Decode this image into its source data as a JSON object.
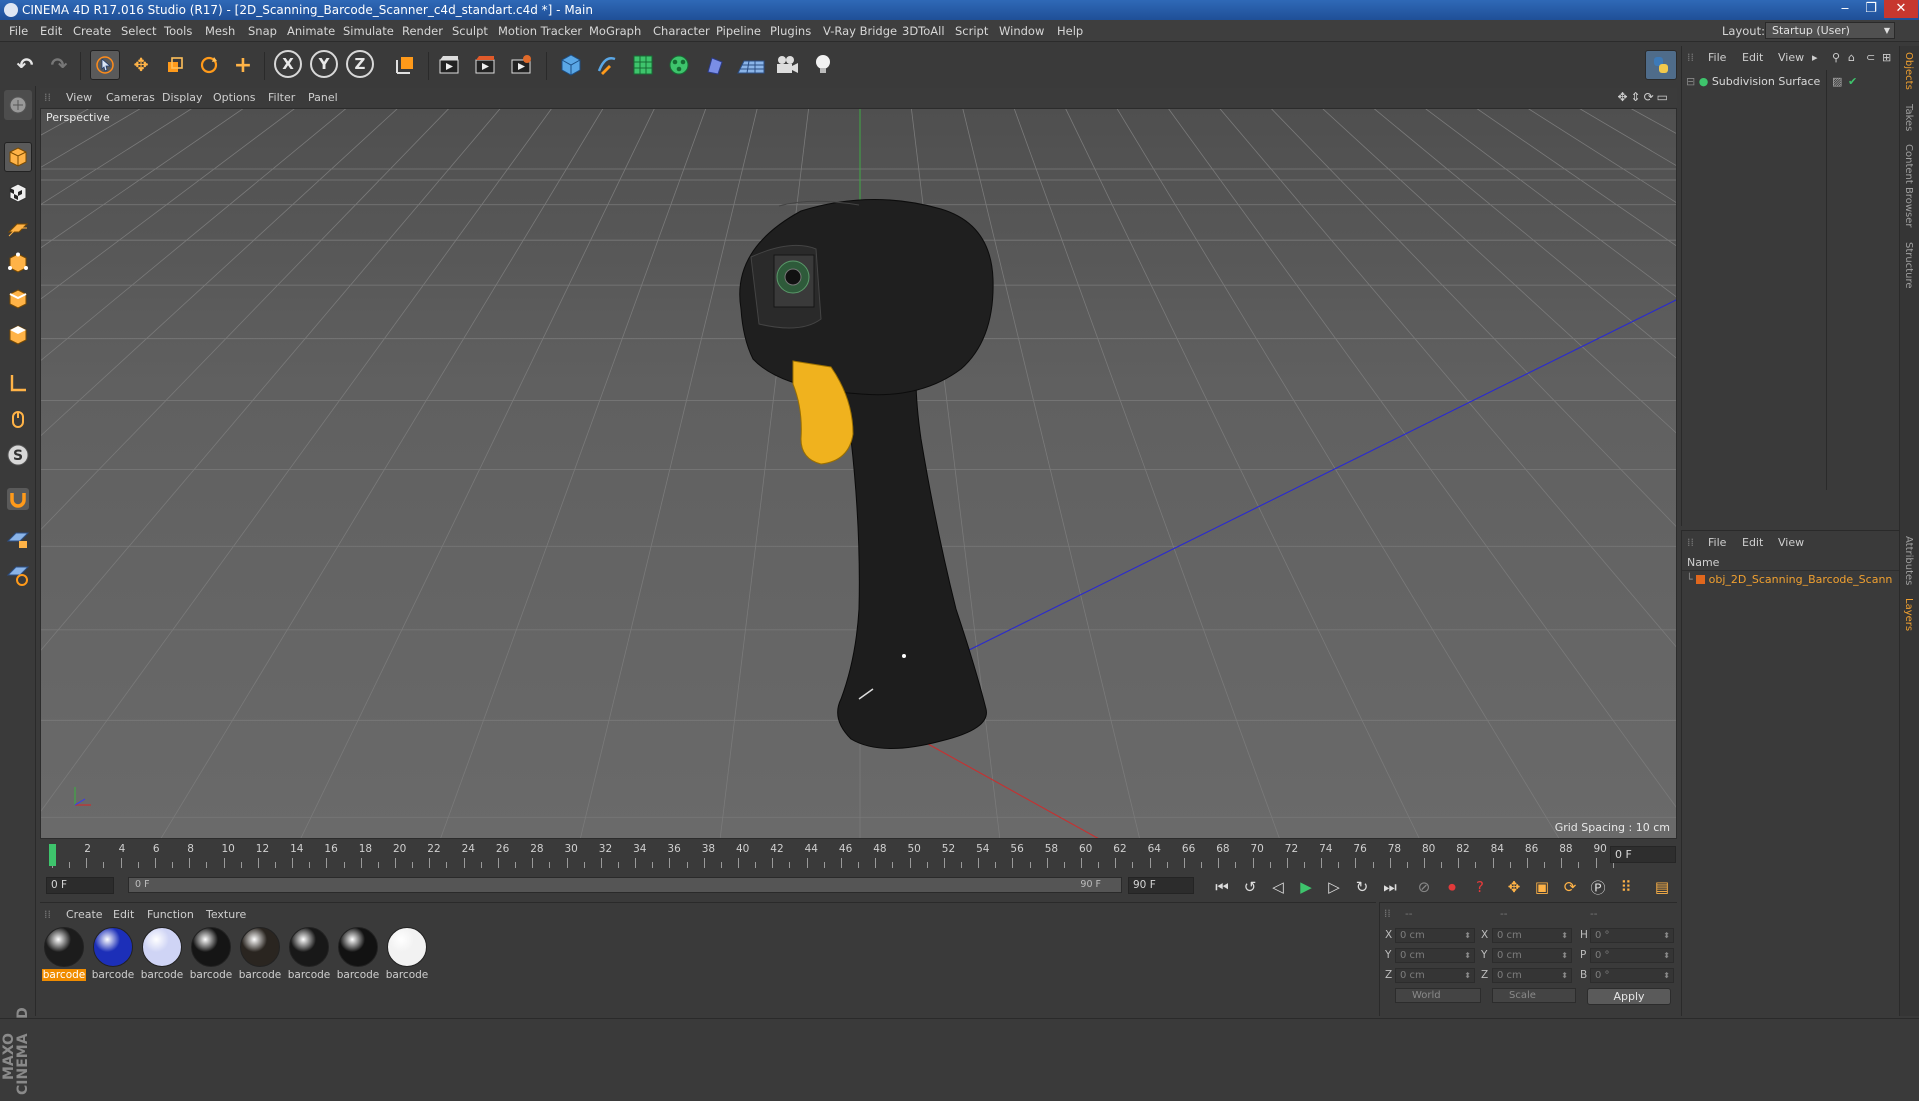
{
  "window": {
    "title": "CINEMA 4D R17.016 Studio (R17) - [2D_Scanning_Barcode_Scanner_c4d_standart.c4d *] - Main",
    "minimize": "‒",
    "maximize": "❐",
    "close": "✕"
  },
  "menubar": {
    "items": [
      "File",
      "Edit",
      "Create",
      "Select",
      "Tools",
      "Mesh",
      "Snap",
      "Animate",
      "Simulate",
      "Render",
      "Sculpt",
      "Motion Tracker",
      "MoGraph",
      "Character",
      "Pipeline",
      "Plugins",
      "V-Ray Bridge",
      "3DToAll",
      "Script",
      "Window",
      "Help"
    ],
    "layout_label": "Layout:",
    "layout_value": "Startup (User)"
  },
  "toolbar": {
    "icons": [
      "undo-icon",
      "redo-icon",
      "select-icon",
      "move-icon",
      "scale-icon",
      "rotate-icon",
      "transform-icon",
      "x-axis-icon",
      "y-axis-icon",
      "z-axis-icon",
      "coordinate-system-icon",
      "render-view-icon",
      "render-picture-icon",
      "render-settings-icon",
      "cube-icon",
      "pen-icon",
      "subdivision-icon",
      "cloner-icon",
      "deformer-icon",
      "floor-icon",
      "camera-icon",
      "light-icon"
    ],
    "x_label": "X",
    "y_label": "Y",
    "z_label": "Z",
    "python_icon": "python-icon"
  },
  "left_tools": {
    "icons": [
      "make-editable-icon",
      "model-mode-icon",
      "texture-mode-icon",
      "workplane-icon",
      "points-mode-icon",
      "edges-mode-icon",
      "polygons-mode-icon",
      "axis-icon",
      "tweak-icon",
      "snap-s-icon",
      "magnet-icon",
      "grid-lock-icon",
      "solo-icon"
    ]
  },
  "viewport": {
    "menu": [
      "View",
      "Cameras",
      "Display",
      "Options",
      "Filter",
      "Panel"
    ],
    "camera_label": "Perspective",
    "grid_spacing": "Grid Spacing : 10 cm"
  },
  "timeline": {
    "ticks": [
      "0",
      "2",
      "4",
      "6",
      "8",
      "10",
      "12",
      "14",
      "16",
      "18",
      "20",
      "22",
      "24",
      "26",
      "28",
      "30",
      "32",
      "34",
      "36",
      "38",
      "40",
      "42",
      "44",
      "46",
      "48",
      "50",
      "52",
      "54",
      "56",
      "58",
      "60",
      "62",
      "64",
      "66",
      "68",
      "70",
      "72",
      "74",
      "76",
      "78",
      "80",
      "82",
      "84",
      "86",
      "88",
      "90"
    ],
    "end_frame": "0 F",
    "current_frame": "0 F",
    "slider_start": "0 F",
    "slider_end": "90 F",
    "max_frame": "90 F"
  },
  "materials": {
    "menu": [
      "Create",
      "Edit",
      "Function",
      "Texture"
    ],
    "items": [
      {
        "label": "barcode",
        "color": "#1c1c1c",
        "selected": true
      },
      {
        "label": "barcode",
        "color": "#1c2fb8",
        "selected": false
      },
      {
        "label": "barcode",
        "color": "#cfd4f5",
        "selected": false
      },
      {
        "label": "barcode",
        "color": "#151515",
        "selected": false
      },
      {
        "label": "barcode",
        "color": "#2a2520",
        "selected": false
      },
      {
        "label": "barcode",
        "color": "#181818",
        "selected": false
      },
      {
        "label": "barcode",
        "color": "#121212",
        "selected": false
      },
      {
        "label": "barcode",
        "color": "#f2f2f2",
        "selected": false
      }
    ],
    "logo": "MAXON CINEMA 4D"
  },
  "coordinates": {
    "header": [
      "--",
      "--",
      "--"
    ],
    "pos": [
      {
        "axis": "X",
        "value": "0 cm"
      },
      {
        "axis": "Y",
        "value": "0 cm"
      },
      {
        "axis": "Z",
        "value": "0 cm"
      }
    ],
    "size": [
      {
        "axis": "X",
        "value": "0 cm"
      },
      {
        "axis": "Y",
        "value": "0 cm"
      },
      {
        "axis": "Z",
        "value": "0 cm"
      }
    ],
    "rot": [
      {
        "axis": "H",
        "value": "0 °"
      },
      {
        "axis": "P",
        "value": "0 °"
      },
      {
        "axis": "B",
        "value": "0 °"
      }
    ],
    "world": "World",
    "scale": "Scale",
    "apply": "Apply"
  },
  "objects": {
    "menu": [
      "File",
      "Edit",
      "View"
    ],
    "item": "Subdivision Surface"
  },
  "layers": {
    "menu": [
      "File",
      "Edit",
      "View"
    ],
    "name_header": "Name",
    "item": "obj_2D_Scanning_Barcode_Scann"
  },
  "side_tabs": [
    "Objects",
    "Takes",
    "Content Browser",
    "Structure",
    "Attributes",
    "Layers"
  ]
}
